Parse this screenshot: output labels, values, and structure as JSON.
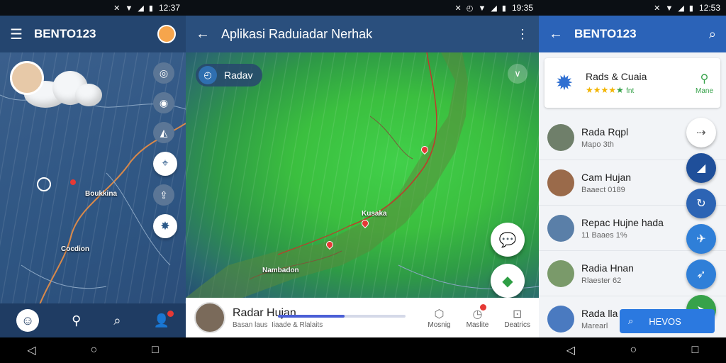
{
  "phone1": {
    "status_time": "12:37",
    "app_title": "BENTO123",
    "map_labels": [
      "Boukkina",
      "Cocdion"
    ],
    "bottom_nav": [
      "home",
      "location",
      "search",
      "alert"
    ]
  },
  "phone2": {
    "status_time": "19:35",
    "app_title": "Aplikasi Raduiadar Nerhak",
    "radar_chip": "Radav",
    "map_labels": [
      "Kusaka",
      "Nambadon"
    ],
    "panel": {
      "title": "Radar Hujan",
      "subtitle_a": "Basan laus",
      "subtitle_b": "Iiaade & Rlalaits",
      "progress": 0.52
    },
    "tabs": [
      {
        "icon": "cube-icon",
        "label": "Mosnig"
      },
      {
        "icon": "timer-icon",
        "label": "Maslite"
      },
      {
        "icon": "dashboard-icon",
        "label": "Deatrics"
      }
    ]
  },
  "phone3": {
    "status_time": "12:53",
    "app_title": "BENTO123",
    "feature": {
      "name": "Rads & Cuaia",
      "location_label": "Mane"
    },
    "items": [
      {
        "name": "Rada Rqpl",
        "sub": "Mapo 3th"
      },
      {
        "name": "Cam Hujan",
        "sub": "Baaect 0189"
      },
      {
        "name": "Repac Hujne hada",
        "sub": "11 Baaes 1%"
      },
      {
        "name": "Radia Hnan",
        "sub": "Rlaester 62"
      },
      {
        "name": "Rada lla",
        "sub": "Marearl"
      }
    ],
    "news_button": "HEVOS"
  }
}
